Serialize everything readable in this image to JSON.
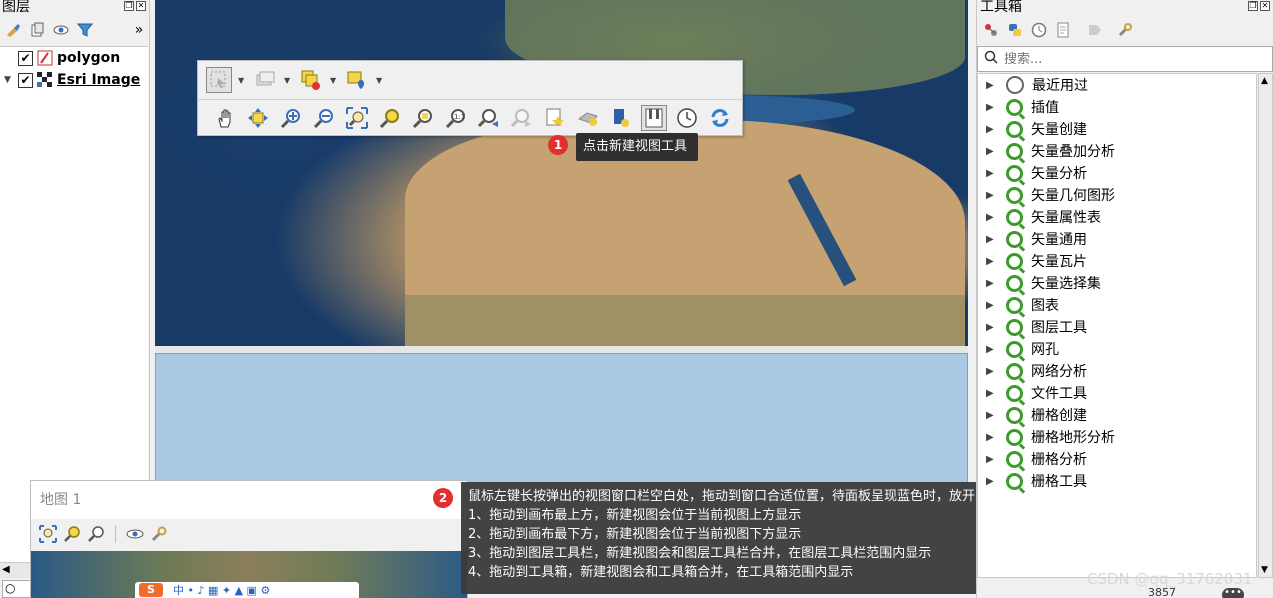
{
  "layers_panel": {
    "title": "图层",
    "layers": [
      {
        "name": "polygon",
        "checked": true
      },
      {
        "name": "Esri Image",
        "checked": true
      }
    ]
  },
  "float_toolbar": {
    "row1": [
      "select-features-icon",
      "attribute-table-icon",
      "deselect-icon",
      "identify-label-icon"
    ],
    "row2": [
      "pan-map-icon",
      "pan-to-selection-icon",
      "zoom-in-icon",
      "zoom-out-icon",
      "zoom-full-icon",
      "zoom-to-selection-icon",
      "zoom-to-layer-icon",
      "zoom-native-icon",
      "zoom-last-icon",
      "zoom-next-icon",
      "new-bookmark-icon",
      "show-bookmarks-icon",
      "temporal-controller-icon",
      "new-map-view-icon",
      "clock-icon",
      "refresh-icon"
    ]
  },
  "callout1": {
    "number": "1",
    "text": "点击新建视图工具"
  },
  "callout2": {
    "number": "2",
    "lines": [
      "鼠标左键长按弹出的视图窗口栏空白处，拖动到窗口合适位置，待面板呈现蓝色时，放开鼠标后窗口嵌入到相应位置：",
      "1、拖动到画布最上方，新建视图会位于当前视图上方显示",
      "2、拖动到画布最下方，新建视图会位于当前视图下方显示",
      "3、拖动到图层工具栏，新建视图会和图层工具栏合并，在图层工具栏范围内显示",
      "4、拖动到工具箱，新建视图会和工具箱合并，在工具箱范围内显示"
    ]
  },
  "map_view": {
    "title": "地图 1"
  },
  "toolbox_panel": {
    "title": "工具箱",
    "search_placeholder": "搜索...",
    "items": [
      "最近用过",
      "插值",
      "矢量创建",
      "矢量叠加分析",
      "矢量分析",
      "矢量几何图形",
      "矢量属性表",
      "矢量通用",
      "矢量瓦片",
      "矢量选择集",
      "图表",
      "图层工具",
      "网孔",
      "网络分析",
      "文件工具",
      "栅格创建",
      "栅格地形分析",
      "栅格分析",
      "栅格工具"
    ]
  },
  "status": {
    "crs": "3857"
  },
  "watermark": "CSDN @qq_31762031",
  "colors": {
    "accent_red": "#e03030",
    "qgis_green": "#3d9a2c",
    "drop_zone_blue": "#a9c8e3"
  }
}
